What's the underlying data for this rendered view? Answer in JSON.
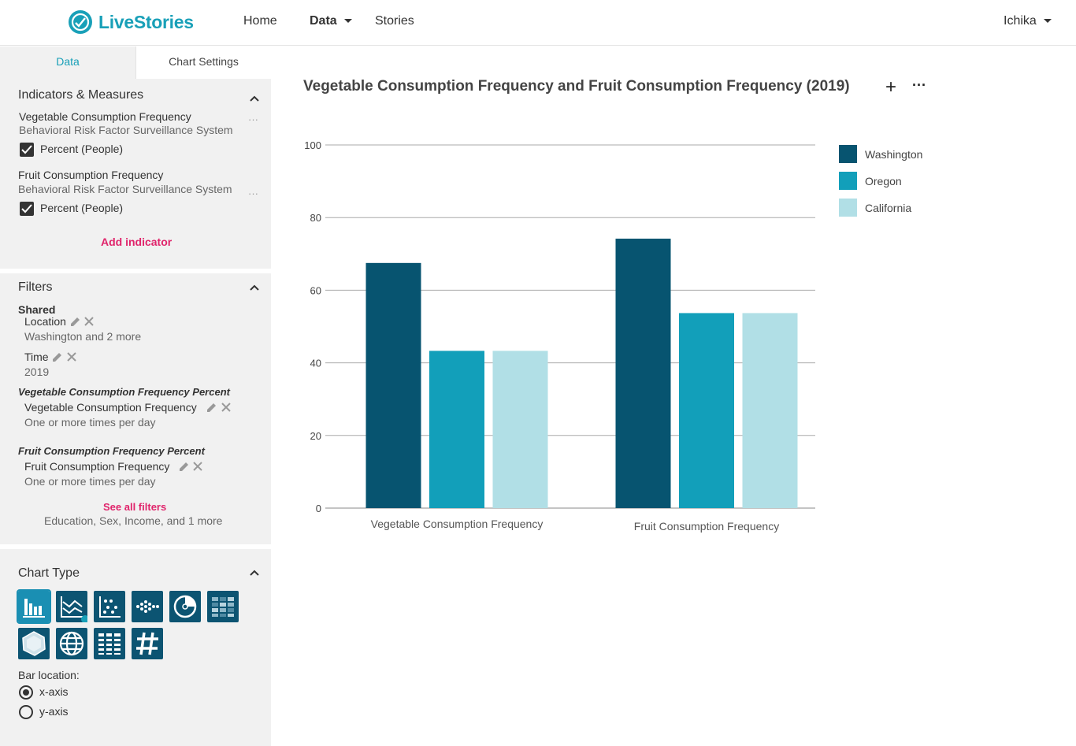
{
  "app": {
    "name": "LiveStories"
  },
  "nav": {
    "home": "Home",
    "data": "Data",
    "stories": "Stories",
    "user": "Ichika"
  },
  "tabs": {
    "data": "Data",
    "chart_settings": "Chart Settings"
  },
  "indicators": {
    "title": "Indicators & Measures",
    "items": [
      {
        "name": "Vegetable Consumption Frequency",
        "source": "Behavioral Risk Factor Surveillance  System",
        "measure": "Percent (People)"
      },
      {
        "name": "Fruit Consumption Frequency",
        "source": "Behavioral Risk Factor Surveillance System",
        "measure": "Percent (People)"
      }
    ],
    "add_label": "Add indicator",
    "more": "···"
  },
  "filters": {
    "title": "Filters",
    "shared_label": "Shared",
    "location": {
      "label": "Location",
      "value": "Washington and 2 more"
    },
    "time": {
      "label": "Time",
      "value": "2019"
    },
    "veg": {
      "group": "Vegetable Consumption Frequency Percent",
      "label": "Vegetable Consumption Frequency",
      "value": "One or more times per day"
    },
    "fruit": {
      "group": "Fruit Consumption Frequency Percent",
      "label": "Fruit Consumption Frequency",
      "value": "One or more times per day"
    },
    "see_all": "See all filters",
    "see_all_sub": "Education, Sex, Income, and 1 more"
  },
  "chart_type": {
    "title": "Chart Type",
    "icons": [
      "bar-chart-icon",
      "line-chart-icon",
      "dot-plot-icon",
      "beeswarm-icon",
      "pie-chart-icon",
      "heatmap-icon",
      "radar-chart-icon",
      "map-globe-icon",
      "table-icon",
      "number-icon"
    ],
    "bar_location_label": "Bar location:",
    "options": [
      "x-axis",
      "y-axis"
    ],
    "selected": "x-axis"
  },
  "colors": {
    "washington": "#075470",
    "oregon": "#129fba",
    "california": "#b1dfe6",
    "accent": "#19a0b8",
    "link": "#e0246b"
  },
  "chart_header": {
    "title": "Vegetable Consumption Frequency and Fruit Consumption Frequency (2019)",
    "add": "+",
    "more": "···"
  },
  "chart_data": {
    "type": "bar",
    "title": "Vegetable Consumption Frequency and Fruit Consumption Frequency (2019)",
    "categories": [
      "Vegetable Consumption Frequency",
      "Fruit Consumption Frequency"
    ],
    "series": [
      {
        "name": "Washington",
        "values": [
          67.5,
          74.2
        ]
      },
      {
        "name": "Oregon",
        "values": [
          43.3,
          53.7
        ]
      },
      {
        "name": "California",
        "values": [
          43.3,
          53.7
        ]
      }
    ],
    "ylim": [
      0,
      100
    ],
    "yticks": [
      0,
      20,
      40,
      60,
      80,
      100
    ],
    "grid": true,
    "legend": "right"
  }
}
